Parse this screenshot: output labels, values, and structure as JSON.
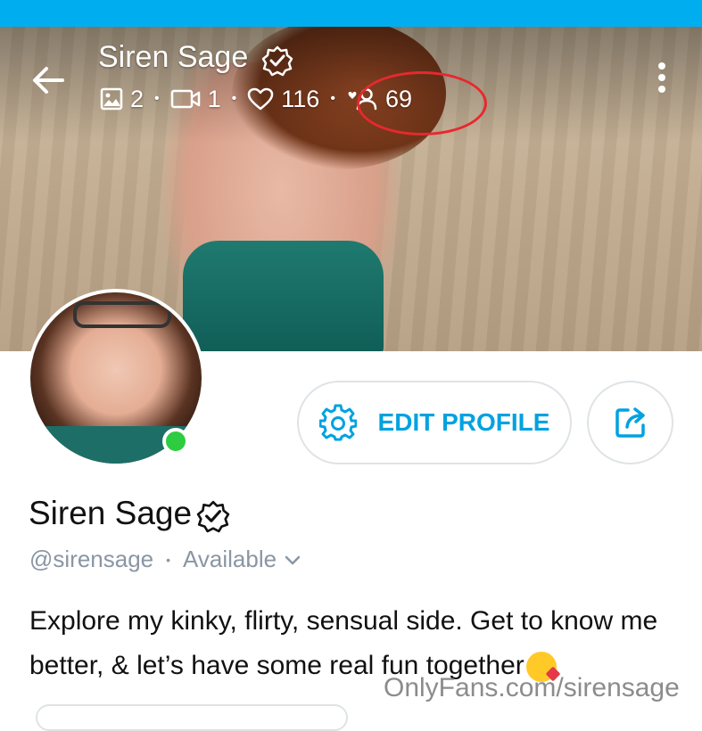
{
  "header": {
    "name": "Siren Sage",
    "stats": {
      "photos": "2",
      "videos": "1",
      "likes": "116",
      "fans": "69"
    }
  },
  "actions": {
    "edit_profile_label": "EDIT PROFILE"
  },
  "profile": {
    "name": "Siren Sage",
    "handle": "@sirensage",
    "separator": "•",
    "availability": "Available",
    "bio": "Explore my kinky, flirty, sensual side. Get to know me better, & let’s have some real fun together"
  },
  "watermark": "OnlyFans.com/sirensage",
  "colors": {
    "accent": "#00a2e0",
    "status_bar": "#00aeef",
    "online": "#2ecc40",
    "annotation": "#e8282f"
  },
  "icons": [
    "back-arrow-icon",
    "verified-icon",
    "image-icon",
    "video-icon",
    "heart-icon",
    "fans-icon",
    "more-vertical-icon",
    "gear-icon",
    "share-icon",
    "chevron-down-icon"
  ]
}
